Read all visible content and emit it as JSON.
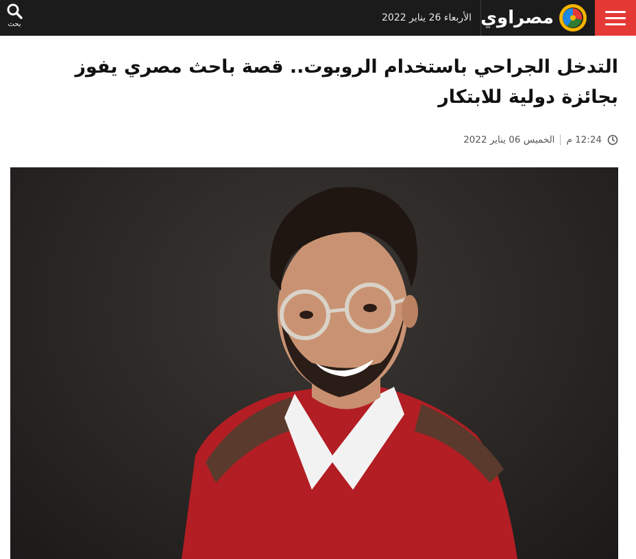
{
  "header": {
    "site_name": "مصراوي",
    "date": "الأربعاء 26 يناير 2022",
    "search_label": "بحث",
    "colors": {
      "bar": "#1b1b1b",
      "menu": "#e53935",
      "logo_ring": "#f5b400"
    }
  },
  "article": {
    "title": "التدخل الجراحي باستخدام الروبوت.. قصة باحث مصري يفوز بجائزة دولية للابتكار",
    "time": "12:24 م",
    "date": "الخميس 06 يناير 2022"
  },
  "icons": {
    "menu": "hamburger-icon",
    "search": "magnifier-icon",
    "clock": "clock-icon",
    "logo": "masrawy-logo-icon"
  }
}
